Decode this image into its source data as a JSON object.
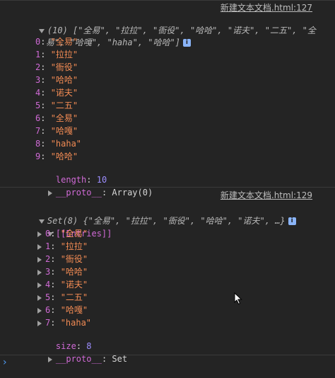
{
  "entry1": {
    "source": "新建文本文档.html:127",
    "summary_line1": "(10) [\"全易\", \"拉拉\", \"衙役\", \"哈哈\", \"诺夫\", \"二五\", \"全",
    "summary_line2": "易\", \"哈嘎\", \"haha\", \"哈哈\"]",
    "items": [
      {
        "key": "0",
        "value": "\"全易\""
      },
      {
        "key": "1",
        "value": "\"拉拉\""
      },
      {
        "key": "2",
        "value": "\"衙役\""
      },
      {
        "key": "3",
        "value": "\"哈哈\""
      },
      {
        "key": "4",
        "value": "\"诺夫\""
      },
      {
        "key": "5",
        "value": "\"二五\""
      },
      {
        "key": "6",
        "value": "\"全易\""
      },
      {
        "key": "7",
        "value": "\"哈嘎\""
      },
      {
        "key": "8",
        "value": "\"haha\""
      },
      {
        "key": "9",
        "value": "\"哈哈\""
      }
    ],
    "length_key": "length",
    "length_value": "10",
    "proto_key": "__proto__",
    "proto_value": "Array(0)"
  },
  "entry2": {
    "source": "新建文本文档.html:129",
    "summary": "Set(8) {\"全易\", \"拉拉\", \"衙役\", \"哈哈\", \"诺夫\", …}",
    "entries_label": "[[Entries]]",
    "items": [
      {
        "key": "0",
        "value": "\"全易\""
      },
      {
        "key": "1",
        "value": "\"拉拉\""
      },
      {
        "key": "2",
        "value": "\"衙役\""
      },
      {
        "key": "3",
        "value": "\"哈哈\""
      },
      {
        "key": "4",
        "value": "\"诺夫\""
      },
      {
        "key": "5",
        "value": "\"二五\""
      },
      {
        "key": "6",
        "value": "\"哈嘎\""
      },
      {
        "key": "7",
        "value": "\"haha\""
      }
    ],
    "size_key": "size",
    "size_value": "8",
    "proto_key": "__proto__",
    "proto_value": "Set"
  },
  "info_icon": "i",
  "prompt_symbol": "›",
  "colors": {
    "background": "#242424",
    "key": "#d06ad6",
    "string": "#f28b54",
    "number": "#9d8eff",
    "prompt": "#4e9cf5"
  }
}
